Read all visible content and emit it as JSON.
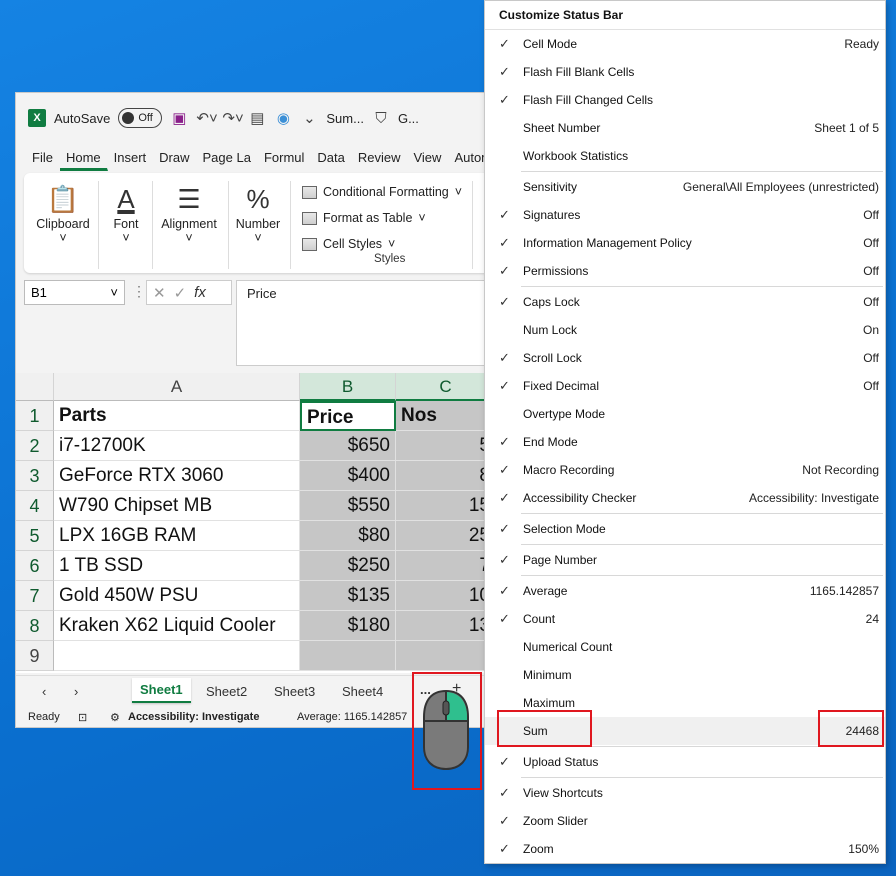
{
  "excel": {
    "titlebar": {
      "autosave_label": "AutoSave",
      "autosave_state": "Off",
      "doc_title": "Sum...",
      "sensitivity_short": "G..."
    },
    "tabs": [
      "File",
      "Home",
      "Insert",
      "Draw",
      "Page La",
      "Formul",
      "Data",
      "Review",
      "View",
      "Automa"
    ],
    "ribbon": {
      "clipboard": "Clipboard",
      "font": "Font",
      "alignment": "Alignment",
      "number": "Number",
      "conditional_formatting": "Conditional Formatting",
      "format_as_table": "Format as Table",
      "cell_styles": "Cell Styles",
      "styles_group": "Styles"
    },
    "namebox": "B1",
    "fx": "fx",
    "formula": "Price",
    "columns": [
      "A",
      "B",
      "C"
    ],
    "rows": [
      "1",
      "2",
      "3",
      "4",
      "5",
      "6",
      "7",
      "8",
      "9"
    ],
    "cells": [
      [
        "Parts",
        "Price",
        "Nos"
      ],
      [
        "i7-12700K",
        "$650",
        "5"
      ],
      [
        "GeForce RTX 3060",
        "$400",
        "8"
      ],
      [
        "W790 Chipset MB",
        "$550",
        "15"
      ],
      [
        "LPX 16GB RAM",
        "$80",
        "25"
      ],
      [
        "1 TB SSD",
        "$250",
        "7"
      ],
      [
        "Gold 450W PSU",
        "$135",
        "10"
      ],
      [
        "Kraken X62 Liquid Cooler",
        "$180",
        "13"
      ],
      [
        "",
        "",
        ""
      ]
    ],
    "sheets": [
      "Sheet1",
      "Sheet2",
      "Sheet3",
      "Sheet4"
    ],
    "sheet_more": "...",
    "sheet_add": "+",
    "status": {
      "mode": "Ready",
      "accessibility": "Accessibility: Investigate",
      "average": "Average: 1165.142857"
    }
  },
  "menu": {
    "title": "Customize Status Bar",
    "items": [
      {
        "label": "Cell Mode",
        "value": "Ready",
        "checked": true
      },
      {
        "label": "Flash Fill Blank Cells",
        "value": "",
        "checked": true
      },
      {
        "label": "Flash Fill Changed Cells",
        "value": "",
        "checked": true
      },
      {
        "label": "Sheet Number",
        "value": "Sheet 1 of 5",
        "checked": false
      },
      {
        "label": "Workbook Statistics",
        "value": "",
        "checked": false
      },
      {
        "label": "Sensitivity",
        "value": "General\\All Employees (unrestricted)",
        "checked": false
      },
      {
        "label": "Signatures",
        "value": "Off",
        "checked": true
      },
      {
        "label": "Information Management Policy",
        "value": "Off",
        "checked": true
      },
      {
        "label": "Permissions",
        "value": "Off",
        "checked": true
      },
      {
        "label": "Caps Lock",
        "value": "Off",
        "checked": true
      },
      {
        "label": "Num Lock",
        "value": "On",
        "checked": false
      },
      {
        "label": "Scroll Lock",
        "value": "Off",
        "checked": true
      },
      {
        "label": "Fixed Decimal",
        "value": "Off",
        "checked": true
      },
      {
        "label": "Overtype Mode",
        "value": "",
        "checked": false
      },
      {
        "label": "End Mode",
        "value": "",
        "checked": true
      },
      {
        "label": "Macro Recording",
        "value": "Not Recording",
        "checked": true
      },
      {
        "label": "Accessibility Checker",
        "value": "Accessibility: Investigate",
        "checked": true
      },
      {
        "label": "Selection Mode",
        "value": "",
        "checked": true
      },
      {
        "label": "Page Number",
        "value": "",
        "checked": true
      },
      {
        "label": "Average",
        "value": "1165.142857",
        "checked": true
      },
      {
        "label": "Count",
        "value": "24",
        "checked": true
      },
      {
        "label": "Numerical Count",
        "value": "",
        "checked": false
      },
      {
        "label": "Minimum",
        "value": "",
        "checked": false
      },
      {
        "label": "Maximum",
        "value": "",
        "checked": false
      },
      {
        "label": "Sum",
        "value": "24468",
        "checked": false
      },
      {
        "label": "Upload Status",
        "value": "",
        "checked": true
      },
      {
        "label": "View Shortcuts",
        "value": "",
        "checked": true
      },
      {
        "label": "Zoom Slider",
        "value": "",
        "checked": true
      },
      {
        "label": "Zoom",
        "value": "150%",
        "checked": true
      }
    ]
  },
  "colors": {
    "excel_green": "#107c41",
    "highlight_red": "#e0171f",
    "desktop_blue": "#0a74d6"
  }
}
